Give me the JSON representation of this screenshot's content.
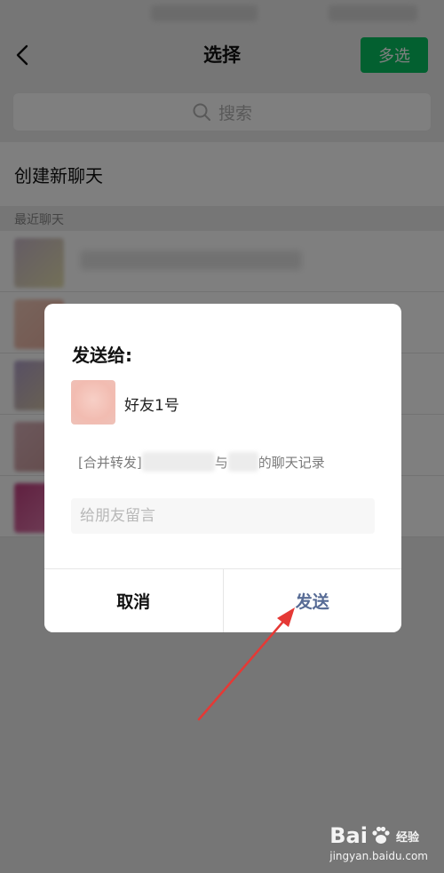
{
  "nav": {
    "title": "选择",
    "multi_select_label": "多选"
  },
  "search": {
    "placeholder": "搜索"
  },
  "new_chat_label": "创建新聊天",
  "recent_section_label": "最近聊天",
  "dialog": {
    "title": "发送给:",
    "recipient_name": "好友1号",
    "preview_prefix": "[合并转发]",
    "preview_middle": "与",
    "preview_suffix": "的聊天记录",
    "message_placeholder": "给朋友留言",
    "cancel_label": "取消",
    "send_label": "发送"
  },
  "colors": {
    "accent_green": "#07c160",
    "send_blue": "#576b95",
    "annotation_red": "#e53935"
  },
  "watermark": {
    "brand": "Bai",
    "brand_suffix": "百",
    "sub": "经验",
    "url": "jingyan.baidu.com"
  }
}
